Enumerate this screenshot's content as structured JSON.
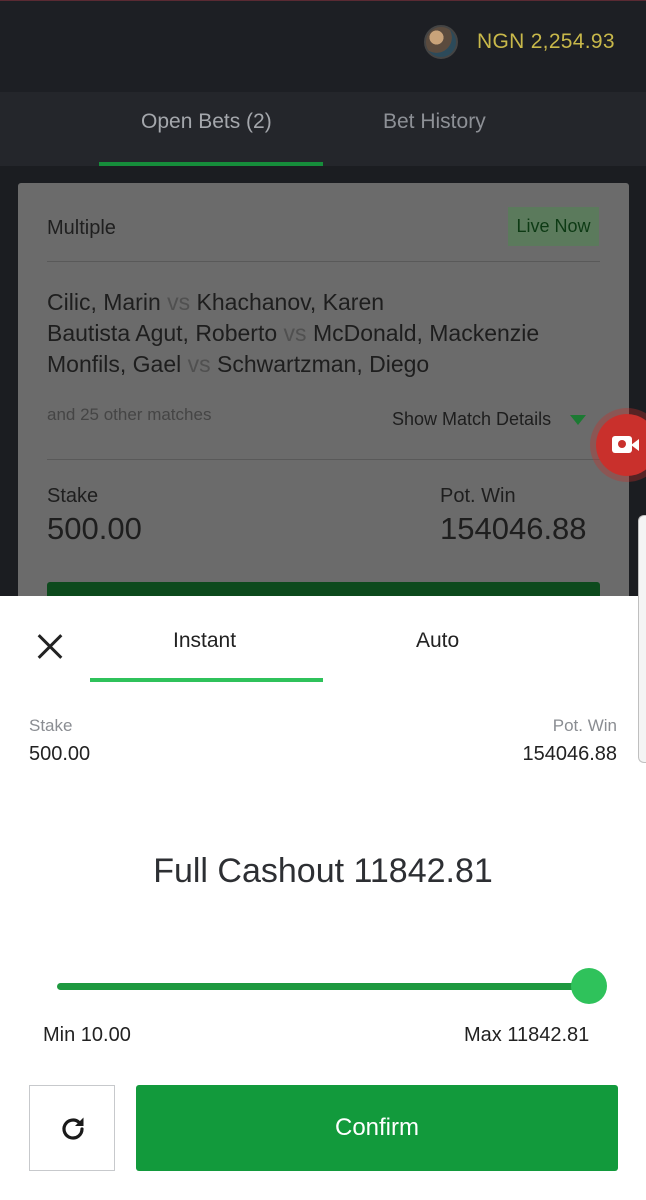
{
  "header": {
    "balance": "NGN 2,254.93"
  },
  "tabs": {
    "open_bets": "Open Bets (2)",
    "bet_history": "Bet History"
  },
  "bet_card": {
    "type": "Multiple",
    "live_badge": "Live Now",
    "matches": [
      {
        "home": "Cilic, Marin",
        "vs": "vs",
        "away": "Khachanov, Karen"
      },
      {
        "home": "Bautista Agut, Roberto",
        "vs": "vs",
        "away": "McDonald, Mackenzie"
      },
      {
        "home": "Monfils, Gael",
        "vs": "vs",
        "away": "Schwartzman, Diego"
      }
    ],
    "more_matches": "and 25 other matches",
    "show_details": "Show Match Details",
    "stake_label": "Stake",
    "stake_value": "500.00",
    "pot_win_label": "Pot. Win",
    "pot_win_value": "154046.88"
  },
  "cashout_sheet": {
    "tabs": [
      "Instant",
      "Auto"
    ],
    "stake_label": "Stake",
    "stake_value": "500.00",
    "pot_win_label": "Pot. Win",
    "pot_win_value": "154046.88",
    "title": "Full Cashout 11842.81",
    "min_label": "Min 10.00",
    "max_label": "Max 11842.81",
    "slider_fraction": 1.0,
    "confirm_label": "Confirm"
  },
  "icons": [
    "avatar",
    "chevron-down-icon",
    "screen-record-icon",
    "close-icon",
    "refresh-icon"
  ],
  "colors": {
    "accent_green": "#129a3c",
    "balance_yellow": "#c8b84a",
    "slider_green": "#2fc25b"
  }
}
